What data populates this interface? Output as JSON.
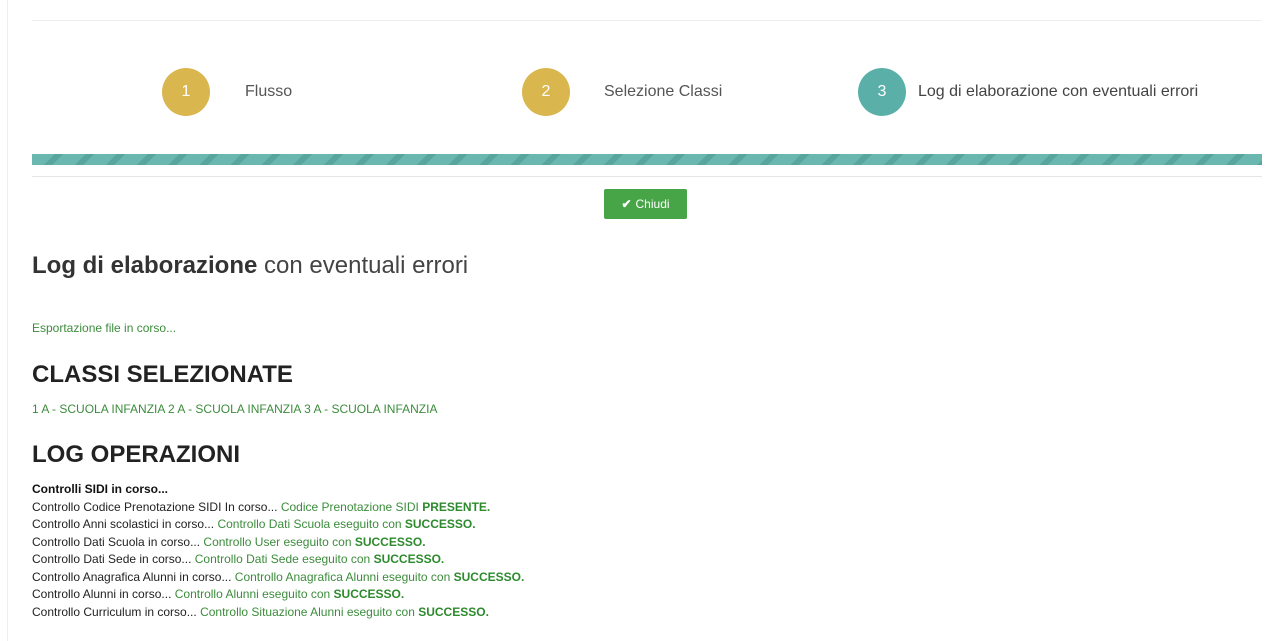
{
  "wizard": {
    "steps": [
      {
        "number": "1",
        "label": "Flusso"
      },
      {
        "number": "2",
        "label": "Selezione Classi"
      },
      {
        "number": "3",
        "label": "Log di elaborazione con eventuali errori"
      }
    ],
    "active_step": 3,
    "colors": {
      "done": "#d9b64e",
      "active": "#5ab0a9",
      "progress": "#6ab7b0"
    }
  },
  "actions": {
    "close_label": "Chiudi",
    "close_color": "#47a447"
  },
  "title": {
    "bold": "Log di elaborazione",
    "rest": "con eventuali errori"
  },
  "export_status": "Esportazione file in corso...",
  "classi": {
    "heading": "CLASSI SELEZIONATE",
    "list": "1 A - SCUOLA INFANZIA 2 A - SCUOLA INFANZIA 3 A - SCUOLA INFANZIA"
  },
  "log": {
    "heading": "LOG OPERAZIONI",
    "subheading": "Controlli SIDI in corso...",
    "lines": [
      {
        "action": "Controllo Codice Prenotazione SIDI In corso...",
        "result": "Codice Prenotazione SIDI",
        "status": "PRESENTE."
      },
      {
        "action": "Controllo Anni scolastici in corso...",
        "result": "Controllo Dati Scuola eseguito con",
        "status": "SUCCESSO."
      },
      {
        "action": "Controllo Dati Scuola in corso...",
        "result": "Controllo User eseguito con",
        "status": "SUCCESSO."
      },
      {
        "action": "Controllo Dati Sede in corso...",
        "result": "Controllo Dati Sede eseguito con",
        "status": "SUCCESSO."
      },
      {
        "action": "Controllo Anagrafica Alunni in corso...",
        "result": "Controllo Anagrafica Alunni eseguito con",
        "status": "SUCCESSO."
      },
      {
        "action": "Controllo Alunni in corso...",
        "result": "Controllo Alunni eseguito con",
        "status": "SUCCESSO."
      },
      {
        "action": "Controllo Curriculum in corso...",
        "result": "Controllo Situazione Alunni eseguito con",
        "status": "SUCCESSO."
      }
    ]
  }
}
